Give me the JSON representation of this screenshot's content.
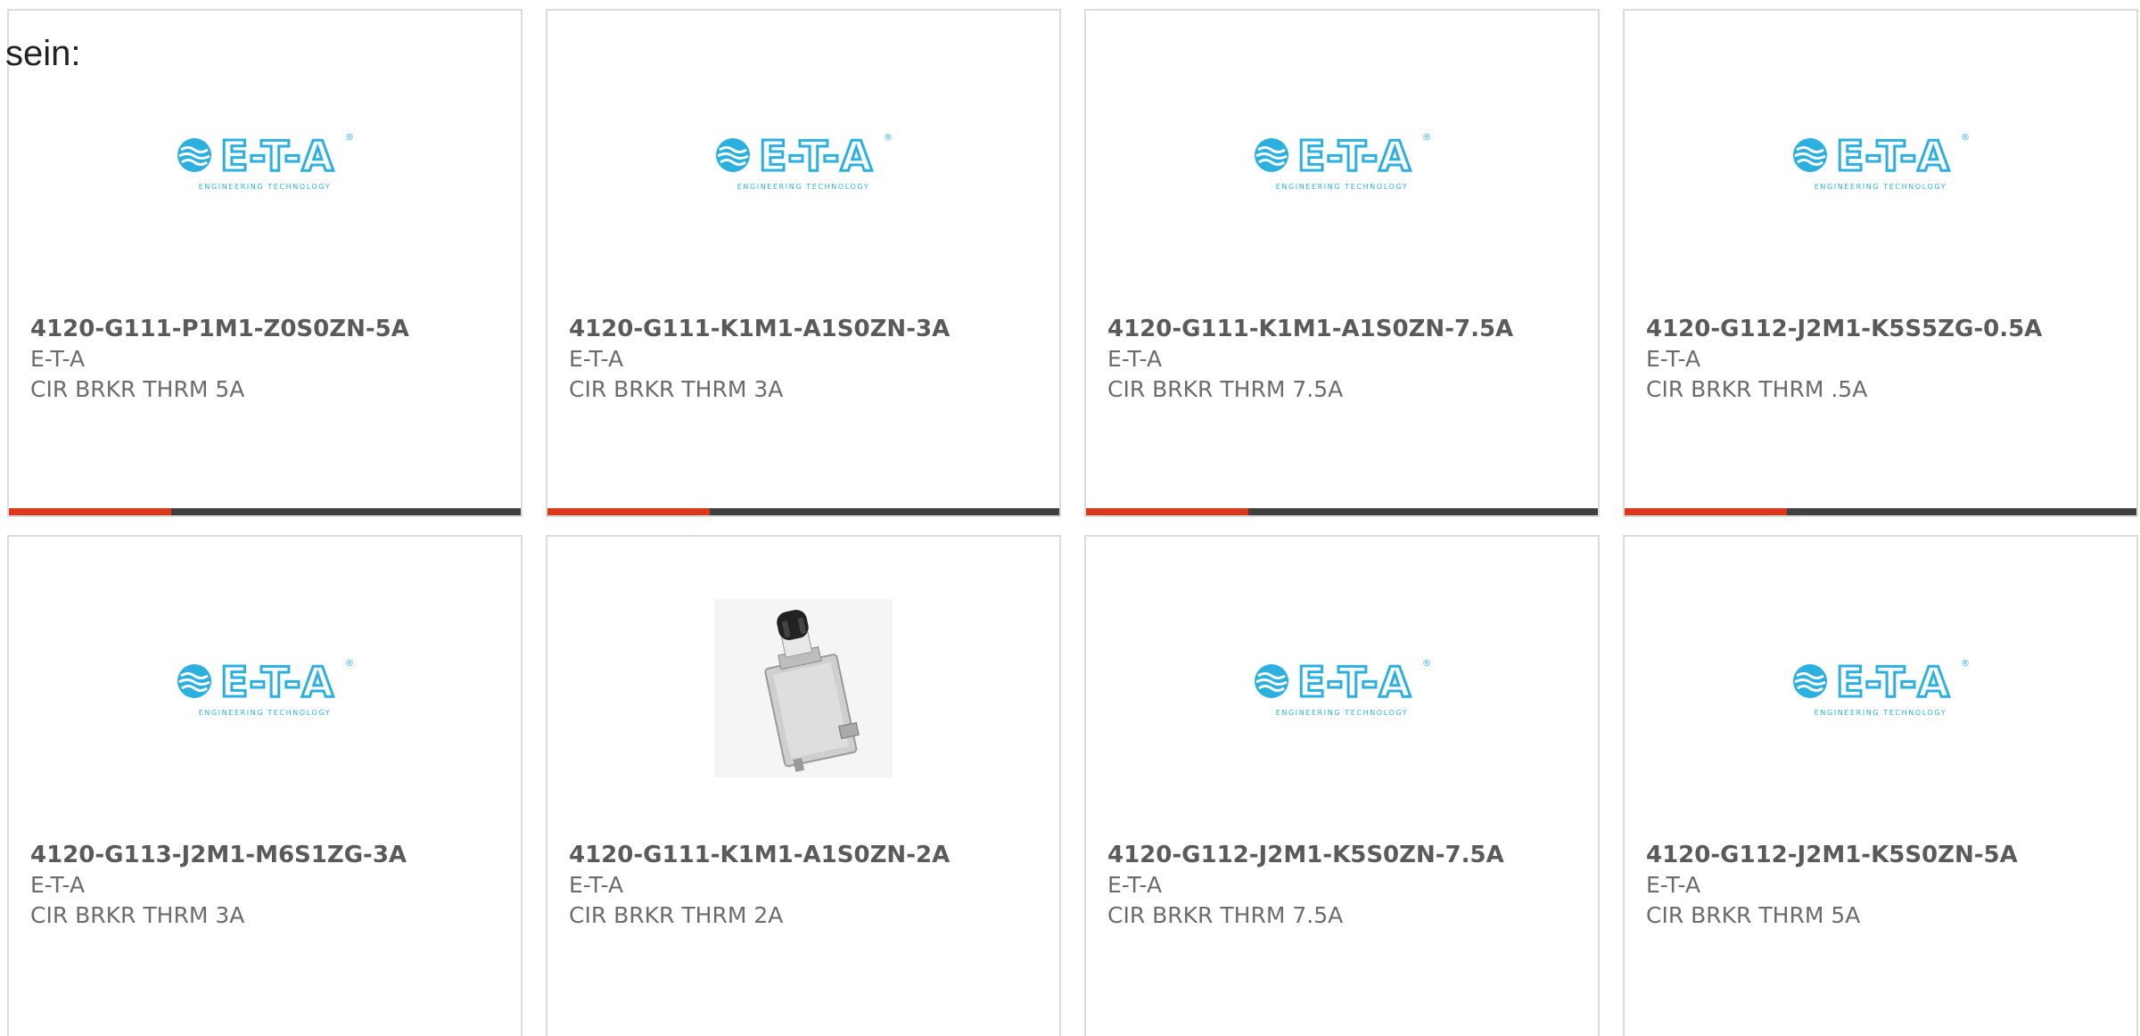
{
  "intro_text": "sein:",
  "logo": {
    "word": "E-T-A",
    "registered": "®",
    "tagline": "ENGINEERING TECHNOLOGY"
  },
  "colors": {
    "accent": "#d9391a",
    "bar": "#404040",
    "logo_blue": "#2bb0e0"
  },
  "products": [
    {
      "title": "4120-G111-P1M1-Z0S0ZN-5A",
      "manufacturer": "E-T-A",
      "description": "CIR BRKR THRM 5A",
      "image": "eta-logo"
    },
    {
      "title": "4120-G111-K1M1-A1S0ZN-3A",
      "manufacturer": "E-T-A",
      "description": "CIR BRKR THRM 3A",
      "image": "eta-logo"
    },
    {
      "title": "4120-G111-K1M1-A1S0ZN-7.5A",
      "manufacturer": "E-T-A",
      "description": "CIR BRKR THRM 7.5A",
      "image": "eta-logo"
    },
    {
      "title": "4120-G112-J2M1-K5S5ZG-0.5A",
      "manufacturer": "E-T-A",
      "description": "CIR BRKR THRM .5A",
      "image": "eta-logo"
    },
    {
      "title": "4120-G113-J2M1-M6S1ZG-3A",
      "manufacturer": "E-T-A",
      "description": "CIR BRKR THRM 3A",
      "image": "eta-logo"
    },
    {
      "title": "4120-G111-K1M1-A1S0ZN-2A",
      "manufacturer": "E-T-A",
      "description": "CIR BRKR THRM 2A",
      "image": "circuit-breaker-photo"
    },
    {
      "title": "4120-G112-J2M1-K5S0ZN-7.5A",
      "manufacturer": "E-T-A",
      "description": "CIR BRKR THRM 7.5A",
      "image": "eta-logo"
    },
    {
      "title": "4120-G112-J2M1-K5S0ZN-5A",
      "manufacturer": "E-T-A",
      "description": "CIR BRKR THRM 5A",
      "image": "eta-logo"
    }
  ]
}
